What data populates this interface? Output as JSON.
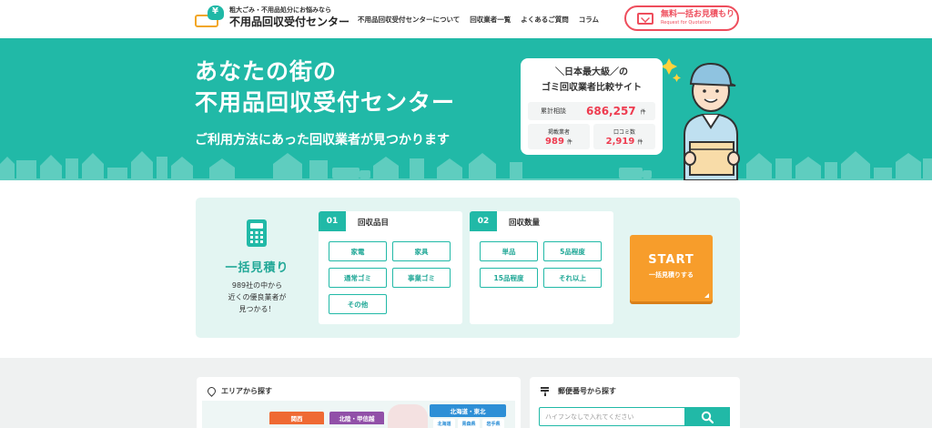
{
  "header": {
    "logo_sub": "粗大ごみ・不用品処分にお悩みなら",
    "logo_main": "不用品回収受付センター",
    "nav": [
      "不用品回収受付センターについて",
      "回収業者一覧",
      "よくあるご質問",
      "コラム"
    ],
    "quote_main": "無料一括お見積もり",
    "quote_sub": "Request for Quotation"
  },
  "hero": {
    "title_line1": "あなたの街の",
    "title_line2": "不用品回収受付センター",
    "subtitle": "ご利用方法にあった回収業者が見つかります",
    "stats": {
      "head_line1": "＼日本最大級／の",
      "head_line2": "ゴミ回収業者比較サイト",
      "consult_label": "累計相談",
      "consult_value": "686,257",
      "consult_unit": "件",
      "vendors_label": "掲載業者",
      "vendors_value": "989",
      "vendors_unit": "件",
      "reviews_label": "口コミ数",
      "reviews_value": "2,919",
      "reviews_unit": "件"
    }
  },
  "estimate": {
    "title": "一括見積り",
    "desc_line1": "989社の中から",
    "desc_line2": "近くの優良業者が",
    "desc_line3": "見つかる！",
    "step1": {
      "num": "01",
      "title": "回収品目",
      "options": [
        "家電",
        "家具",
        "通常ゴミ",
        "事業ゴミ",
        "その他"
      ]
    },
    "step2": {
      "num": "02",
      "title": "回収数量",
      "options": [
        "単品",
        "5品程度",
        "15品程度",
        "それ以上"
      ]
    },
    "start_main": "START",
    "start_sub": "一括見積りする"
  },
  "area": {
    "title": "エリアから探す",
    "regions": [
      "関西",
      "北陸・甲信越",
      "北海道・東北"
    ],
    "sub_regions": [
      "北海道",
      "青森県",
      "岩手県"
    ],
    "colors": {
      "kansai": "#ef6a33",
      "hokuriku": "#9150a8",
      "hokkaido": "#2d8fd6"
    }
  },
  "postal": {
    "title": "郵便番号から探す",
    "placeholder": "ハイフンなしで入れてください"
  },
  "colors": {
    "accent": "#21b9a7",
    "red": "#ee3b4f",
    "orange": "#f79d2b"
  }
}
